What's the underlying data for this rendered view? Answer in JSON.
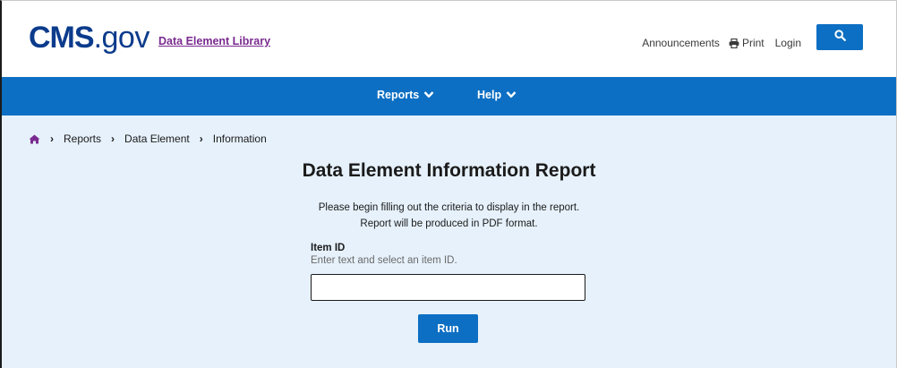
{
  "header": {
    "logo_cms": "CMS",
    "logo_gov": ".gov",
    "library_link": "Data Element Library",
    "announcements": "Announcements",
    "print": "Print",
    "login": "Login",
    "search_icon": "search-icon"
  },
  "nav": {
    "items": [
      {
        "label": "Reports",
        "icon": "chevron-down-icon"
      },
      {
        "label": "Help",
        "icon": "chevron-down-icon"
      }
    ]
  },
  "breadcrumb": {
    "home_icon": "home-icon",
    "items": [
      "Reports",
      "Data Element",
      "Information"
    ]
  },
  "main": {
    "title": "Data Element Information Report",
    "intro_line1": "Please begin filling out the criteria to display in the report.",
    "intro_line2": "Report will be produced in PDF format.",
    "field_label": "Item ID",
    "field_hint": "Enter text and select an item ID.",
    "field_value": "",
    "run_label": "Run"
  },
  "colors": {
    "brand_blue": "#0c6fc3",
    "logo_navy": "#0b3b8c",
    "link_purple": "#7a2a90",
    "page_bg": "#e6f1fb"
  }
}
